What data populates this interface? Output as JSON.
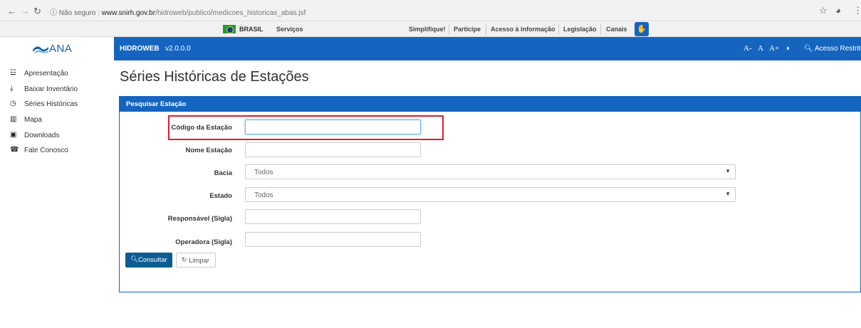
{
  "browser": {
    "back_icon": "arrow-left-icon",
    "forward_icon": "arrow-right-icon",
    "reload_icon": "reload-icon",
    "info_icon": "info-icon",
    "insecure_label": "Não seguro",
    "url_host": "www.snirh.gov.br",
    "url_path": "/hidroweb/publico/medicoes_historicas_abas.jsf",
    "star_icon": "star-icon",
    "extension_icon": "extension-icon",
    "menu_icon": "more-icon"
  },
  "gov_bar": {
    "brasil_label": "BRASIL",
    "items": [
      "Serviços",
      "Simplifique!",
      "Participe",
      "Acesso à informação",
      "Legislação",
      "Canais"
    ],
    "vlibras_icon": "vlibras-hand-icon"
  },
  "sidebar": {
    "logo_text": "ANA",
    "items": [
      {
        "label": "Apresentação",
        "icon": "briefcase-icon",
        "glyph": "☳"
      },
      {
        "label": "Baixar Inventário",
        "icon": "download-icon",
        "glyph": "⤓"
      },
      {
        "label": "Séries Históricas",
        "icon": "clock-icon",
        "glyph": "◷"
      },
      {
        "label": "Mapa",
        "icon": "map-icon",
        "glyph": "▥"
      },
      {
        "label": "Downloads",
        "icon": "downloads-box-icon",
        "glyph": "▣"
      },
      {
        "label": "Fale Conosco",
        "icon": "phone-icon",
        "glyph": "☎"
      }
    ]
  },
  "topnav": {
    "brand": "HIDROWEB",
    "version": "v2.0.0.0",
    "font_decrease": "A-",
    "font_normal": "A",
    "font_increase": "A+",
    "contrast_icon": "contrast-icon",
    "restricted_label": "Acesso Restrito",
    "key_icon": "key-icon"
  },
  "page": {
    "title": "Séries Históricas de Estações"
  },
  "panel": {
    "title": "Pesquisar Estação",
    "fields": {
      "codigo": {
        "label": "Código da Estação",
        "value": ""
      },
      "nome": {
        "label": "Nome Estação",
        "value": ""
      },
      "bacia": {
        "label": "Bacia",
        "value": "Todos"
      },
      "estado": {
        "label": "Estado",
        "value": "Todos"
      },
      "responsavel": {
        "label": "Responsável (Sigla)",
        "value": ""
      },
      "operadora": {
        "label": "Operadora (Sigla)",
        "value": ""
      }
    },
    "buttons": {
      "consultar": "Consultar",
      "limpar": "Limpar"
    }
  },
  "colors": {
    "primary": "#1565c0",
    "button_primary": "#0d5c92",
    "highlight": "#e11d2a"
  }
}
